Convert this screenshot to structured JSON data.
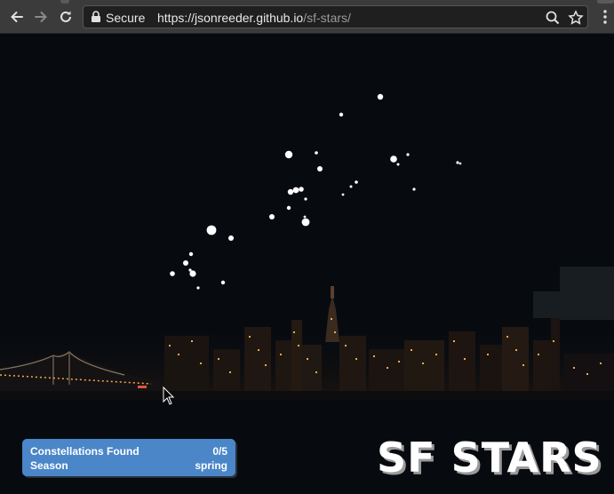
{
  "browser": {
    "secure_label": "Secure",
    "url_host": "https://jsonreeder.github.io",
    "url_path": "/sf-stars/",
    "icons": [
      "back-arrow-icon",
      "forward-arrow-icon",
      "reload-icon",
      "lock-icon",
      "zoom-icon",
      "star-bookmark-icon",
      "menu-dots-icon"
    ]
  },
  "hud": {
    "constellations_label": "Constellations Found",
    "constellations_value": "0/5",
    "season_label": "Season",
    "season_value": "spring"
  },
  "brand": {
    "title": "SF STARS"
  },
  "colors": {
    "sky": "#070b10",
    "hud_bg": "#4a86c8",
    "star": "#ffffff",
    "city_light": "#f5a94a"
  }
}
